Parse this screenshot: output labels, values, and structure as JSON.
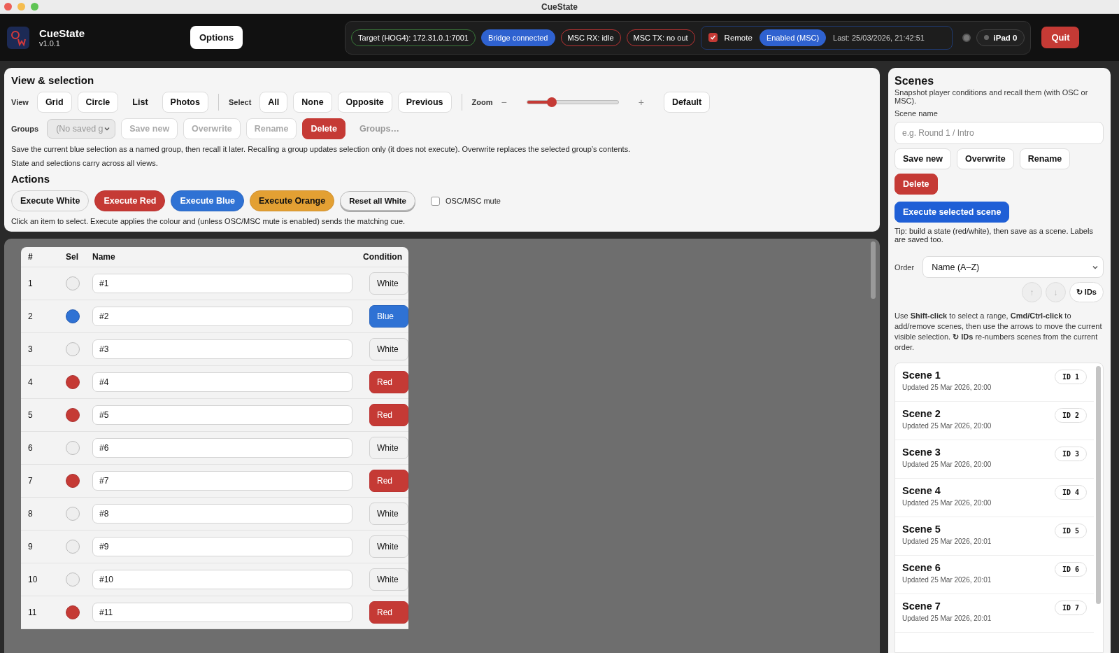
{
  "window": {
    "title": "CueState"
  },
  "header": {
    "app_name": "CueState",
    "version": "v1.0.1",
    "options_button": "Options",
    "status": {
      "target": "Target (HOG4): 172.31.0.1:7001",
      "bridge": "Bridge connected",
      "msc_rx": "MSC RX: idle",
      "msc_tx": "MSC TX: no out",
      "remote": {
        "label": "Remote",
        "checked": true,
        "mode": "Enabled (MSC)",
        "last": "Last: 25/03/2026, 21:42:51"
      },
      "ipad": "iPad 0"
    },
    "quit_button": "Quit"
  },
  "view_selection": {
    "title": "View & selection",
    "view_label": "View",
    "views": [
      {
        "label": "Grid",
        "selected": false
      },
      {
        "label": "Circle",
        "selected": false
      },
      {
        "label": "List",
        "selected": true
      },
      {
        "label": "Photos",
        "selected": false
      }
    ],
    "select_label": "Select",
    "select_buttons": [
      "All",
      "None",
      "Opposite",
      "Previous"
    ],
    "zoom": {
      "label": "Zoom",
      "minus": "−",
      "plus": "+",
      "level": 0.27,
      "default_button": "Default"
    },
    "groups": {
      "label": "Groups",
      "select": {
        "value": "(No saved g",
        "disabled": true
      },
      "buttons": [
        {
          "label": "Save new",
          "kind": "plain",
          "disabled": true
        },
        {
          "label": "Overwrite",
          "kind": "plain",
          "disabled": true
        },
        {
          "label": "Rename",
          "kind": "plain",
          "disabled": true
        },
        {
          "label": "Delete",
          "kind": "danger",
          "disabled": false
        },
        {
          "label": "Groups…",
          "kind": "ghost",
          "disabled": true
        }
      ]
    },
    "help": [
      "Save the current blue selection as a named group, then recall it later. Recalling a group updates selection only (it does not execute). Overwrite replaces the selected group’s contents.",
      "State and selections carry across all views."
    ]
  },
  "actions": {
    "title": "Actions",
    "buttons": [
      {
        "label": "Execute White",
        "kind": "white"
      },
      {
        "label": "Execute Red",
        "kind": "red"
      },
      {
        "label": "Execute Blue",
        "kind": "blue"
      },
      {
        "label": "Execute Orange",
        "kind": "orange"
      },
      {
        "label": "Reset all White",
        "kind": "reset"
      }
    ],
    "mute": {
      "label": "OSC/MSC mute",
      "checked": false
    },
    "help": "Click an item to select. Execute applies the colour and (unless OSC/MSC mute is enabled) sends the matching cue."
  },
  "table": {
    "columns": [
      "#",
      "Sel",
      "Name",
      "Condition"
    ],
    "rows": [
      {
        "number": "1",
        "name": "#1",
        "condition": "White",
        "kind": "white"
      },
      {
        "number": "2",
        "name": "#2",
        "condition": "Blue",
        "kind": "blue"
      },
      {
        "number": "3",
        "name": "#3",
        "condition": "White",
        "kind": "white"
      },
      {
        "number": "4",
        "name": "#4",
        "condition": "Red",
        "kind": "red"
      },
      {
        "number": "5",
        "name": "#5",
        "condition": "Red",
        "kind": "red"
      },
      {
        "number": "6",
        "name": "#6",
        "condition": "White",
        "kind": "white"
      },
      {
        "number": "7",
        "name": "#7",
        "condition": "Red",
        "kind": "red"
      },
      {
        "number": "8",
        "name": "#8",
        "condition": "White",
        "kind": "white"
      },
      {
        "number": "9",
        "name": "#9",
        "condition": "White",
        "kind": "white"
      },
      {
        "number": "10",
        "name": "#10",
        "condition": "White",
        "kind": "white"
      },
      {
        "number": "11",
        "name": "#11",
        "condition": "Red",
        "kind": "red"
      }
    ]
  },
  "scenes": {
    "title": "Scenes",
    "subtitle": "Snapshot player conditions and recall them (with OSC or MSC).",
    "name_label": "Scene name",
    "name_placeholder": "e.g. Round 1 / Intro",
    "buttons": [
      "Save new",
      "Overwrite",
      "Rename"
    ],
    "delete_button": "Delete",
    "execute_button": "Execute selected scene",
    "tip": "Tip: build a state (red/white), then save as a scene. Labels are saved too.",
    "order_label": "Order",
    "order_value": "Name (A–Z)",
    "move_up": "↑",
    "move_down": "↓",
    "renumber_button": "↻ IDs",
    "help": "Use **Shift-click** to select a range, **Cmd/Ctrl-click** to add/remove scenes, then use the arrows to move the current visible selection. **↻ IDs** re-numbers scenes from the current order.",
    "list": [
      {
        "name": "Scene 1",
        "updated": "Updated 25 Mar 2026, 20:00",
        "id": "ID 1"
      },
      {
        "name": "Scene 2",
        "updated": "Updated 25 Mar 2026, 20:00",
        "id": "ID 2"
      },
      {
        "name": "Scene 3",
        "updated": "Updated 25 Mar 2026, 20:00",
        "id": "ID 3"
      },
      {
        "name": "Scene 4",
        "updated": "Updated 25 Mar 2026, 20:00",
        "id": "ID 4"
      },
      {
        "name": "Scene 5",
        "updated": "Updated 25 Mar 2026, 20:01",
        "id": "ID 5"
      },
      {
        "name": "Scene 6",
        "updated": "Updated 25 Mar 2026, 20:01",
        "id": "ID 6"
      },
      {
        "name": "Scene 7",
        "updated": "Updated 25 Mar 2026, 20:01",
        "id": "ID 7"
      }
    ]
  }
}
